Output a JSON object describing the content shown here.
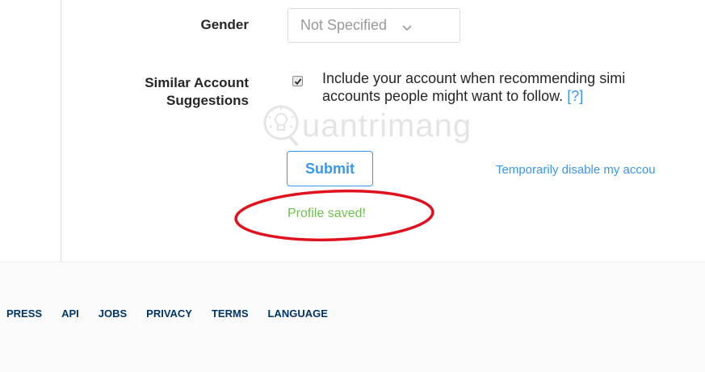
{
  "form": {
    "gender": {
      "label": "Gender",
      "value": "Not Specified"
    },
    "similar": {
      "label_line1": "Similar Account",
      "label_line2": "Suggestions",
      "checked": true,
      "desc_line1": "Include your account when recommending simi",
      "desc_line2": "accounts people might want to follow.",
      "help": "[?]"
    },
    "submit_label": "Submit",
    "disable_link": "Temporarily disable my accou",
    "saved_message": "Profile saved!"
  },
  "watermark": {
    "brand": "uantrimang"
  },
  "annotation": {
    "color": "#e0121e"
  },
  "footer": {
    "links": [
      "PRESS",
      "API",
      "JOBS",
      "PRIVACY",
      "TERMS",
      "LANGUAGE"
    ]
  },
  "colors": {
    "accent": "#3897f0",
    "success": "#70c050",
    "footer_link": "#003569"
  }
}
